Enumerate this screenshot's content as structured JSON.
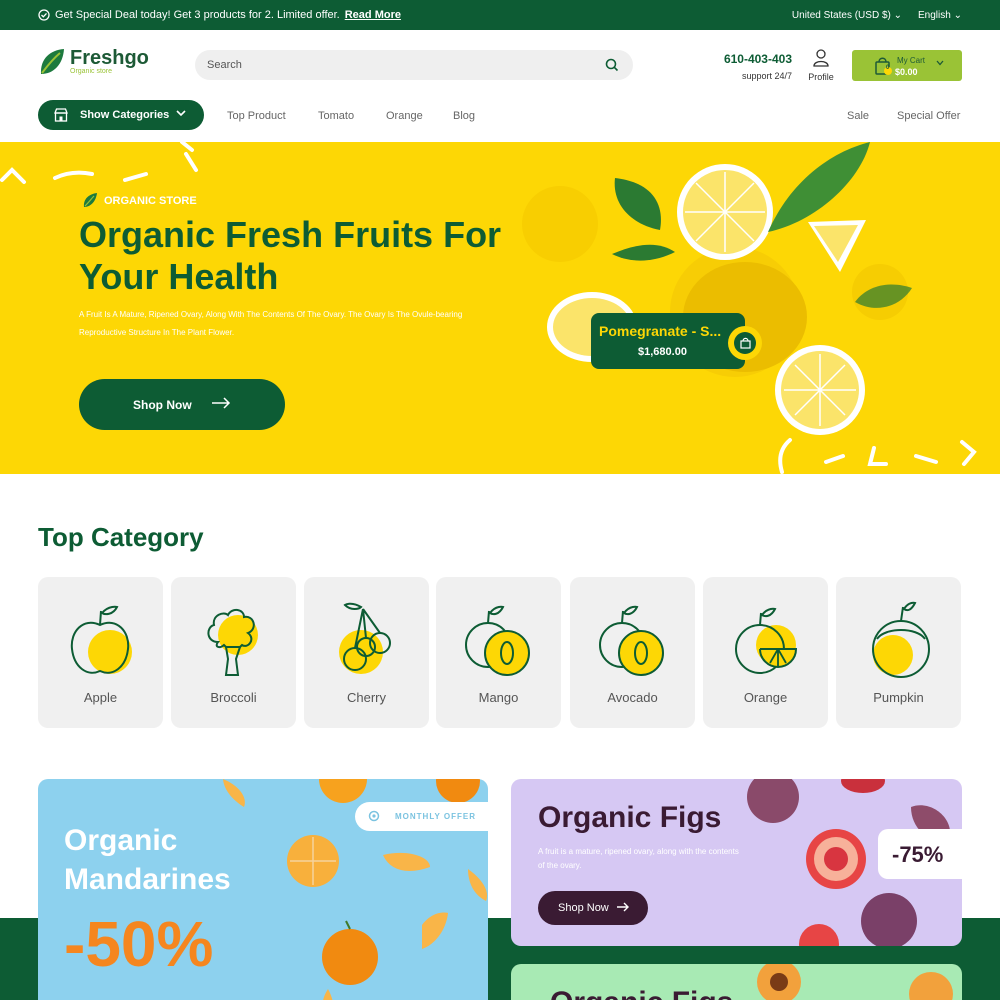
{
  "topbar": {
    "deal_text": "Get Special Deal today! Get 3 products for 2. Limited offer.",
    "read_more": "Read More",
    "currency": "United States (USD $)",
    "language": "English"
  },
  "header": {
    "logo_name": "Freshgo",
    "logo_sub": "Organic store",
    "search_placeholder": "Search",
    "phone": "610-403-403",
    "support": "support 24/7",
    "profile": "Profile",
    "cart_label": "My Cart",
    "cart_amount": "$0.00",
    "cart_count": "0"
  },
  "nav": {
    "show_categories": "Show Categories",
    "links": [
      "Top Product",
      "Tomato",
      "Orange",
      "Blog"
    ],
    "right_links": [
      "Sale",
      "Special Offer"
    ]
  },
  "hero": {
    "tag": "ORGANIC STORE",
    "title_line1": "Organic Fresh Fruits For",
    "title_line2": "Your Health",
    "desc_line1": "A Fruit Is A Mature, Ripened Ovary, Along With The Contents Of The Ovary. The Ovary Is The Ovule-bearing",
    "desc_line2": "Reproductive Structure In The Plant Flower.",
    "button": "Shop Now",
    "popup_name": "Pomegranate - S...",
    "popup_price": "$1,680.00"
  },
  "categories": {
    "title": "Top Category",
    "items": [
      "Apple",
      "Broccoli",
      "Cherry",
      "Mango",
      "Avocado",
      "Orange",
      "Pumpkin"
    ]
  },
  "promos": {
    "mandarines": {
      "title_line1": "Organic",
      "title_line2": "Mandarines",
      "discount": "-50%",
      "badge": "MONTHLY OFFER"
    },
    "figs": {
      "title": "Organic Figs",
      "desc_line1": "A fruit is a mature, ripened ovary, along with the contents",
      "desc_line2": "of the ovary.",
      "button": "Shop Now",
      "discount": "-75%"
    },
    "figs2": {
      "title": "Organic Figs"
    }
  },
  "colors": {
    "primary": "#0d5c34",
    "accent": "#9ac336",
    "yellow": "#fdd705",
    "promo_orange": "#f5861f"
  }
}
